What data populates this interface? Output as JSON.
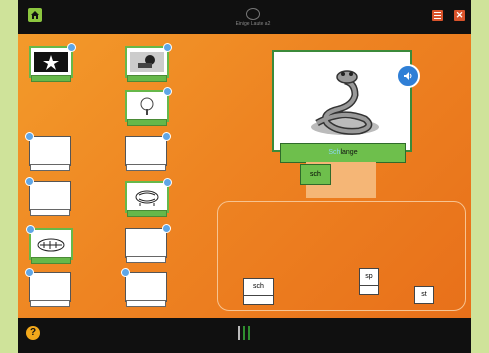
{
  "app": {
    "title": "Einige Laute a2"
  },
  "main": {
    "word_prefix": "Sch",
    "word_rest": "lange",
    "target_slot": "sch"
  },
  "tray": {
    "tiles": [
      {
        "label": "sch"
      },
      {
        "label": "sp"
      },
      {
        "label": "st"
      }
    ]
  },
  "colors": {
    "accent": "#ef8a24",
    "green": "#6ebf4c",
    "blue": "#2f7fd6"
  },
  "icons": [
    "home-icon",
    "menu-icon",
    "close-icon",
    "speaker-icon",
    "help-icon"
  ],
  "footer": {
    "help_glyph": "?"
  }
}
